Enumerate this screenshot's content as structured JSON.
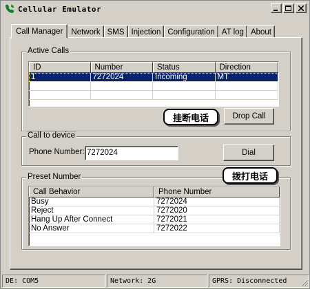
{
  "window": {
    "title": "Cellular Emulator",
    "icon": "phone-icon",
    "controls": [
      "minimize-icon",
      "maximize-icon",
      "close-icon"
    ]
  },
  "tabs": [
    {
      "label": "Call Manager",
      "active": true
    },
    {
      "label": "Network",
      "active": false
    },
    {
      "label": "SMS",
      "active": false
    },
    {
      "label": "Injection",
      "active": false
    },
    {
      "label": "Configuration",
      "active": false
    },
    {
      "label": "AT log",
      "active": false
    },
    {
      "label": "About",
      "active": false
    }
  ],
  "active_calls": {
    "group_label": "Active Calls",
    "columns": [
      "ID",
      "Number",
      "Status",
      "Direction"
    ],
    "rows": [
      {
        "id": "1",
        "number": "7272024",
        "status": "Incoming",
        "direction": "MT",
        "selected": true
      }
    ],
    "drop_button": "Drop Call",
    "annotation": "挂断电话"
  },
  "call_to_device": {
    "group_label": "Call to device",
    "phone_label": "Phone Number:",
    "phone_value": "7272024",
    "dial_button": "Dial",
    "annotation": "拨打电话"
  },
  "preset_number": {
    "group_label": "Preset Number",
    "columns": [
      "Call Behavior",
      "Phone Number"
    ],
    "rows": [
      {
        "behavior": "Busy",
        "number": "7272024"
      },
      {
        "behavior": "Reject",
        "number": "7272020"
      },
      {
        "behavior": "Hang Up After Connect",
        "number": "7272021"
      },
      {
        "behavior": "No Answer",
        "number": "7272022"
      }
    ]
  },
  "status_bar": {
    "de": "DE: COM5",
    "network": "Network: 2G",
    "gprs": "GPRS: Disconnected"
  },
  "colors": {
    "face": "#d4d0c8",
    "selection": "#0a246a",
    "window": "#ffffff"
  }
}
